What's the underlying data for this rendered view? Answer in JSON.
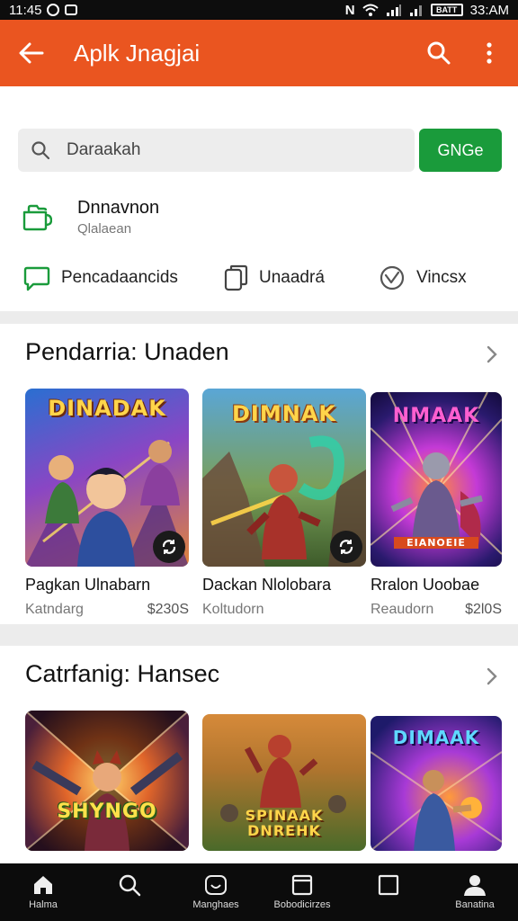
{
  "status_bar": {
    "time": "11:45",
    "right_time": "33:AM",
    "battery": "BATT"
  },
  "toolbar": {
    "title": "Aplk Jnagjai"
  },
  "search": {
    "value": "Daraakah",
    "button_label": "GNGe"
  },
  "download_row": {
    "title": "Dnnavnon",
    "subtitle": "Qlalaean"
  },
  "chips": [
    {
      "label": "Pencadaancids",
      "icon": "chat-bubble-icon"
    },
    {
      "label": "Unaadrá",
      "icon": "device-icon"
    },
    {
      "label": "Vincsx",
      "icon": "checkmark-shield-icon"
    }
  ],
  "section1": {
    "title": "Pendarria: Unaden",
    "cards": [
      {
        "art_title": "DINADAK",
        "title": "Pagkan Ulnabarn",
        "meta": "Katndarg",
        "price": "$230S",
        "badge": true
      },
      {
        "art_title": "DIMNAK",
        "title": "Dackan Nlolobara",
        "meta": "Koltudorn",
        "price": "",
        "badge": true
      },
      {
        "art_title": "NMAAK",
        "art_caption": "EIANOEIE",
        "title": "Rralon Uoobae",
        "meta": "Reaudorn",
        "price": "$2l0S",
        "badge": false
      }
    ]
  },
  "section2": {
    "title": "Catrfanig: Hansec",
    "cards": [
      {
        "art_title": "SHYNGO"
      },
      {
        "art_title": "SPINAAK DNREHK"
      },
      {
        "art_title": "DIMAAK"
      }
    ]
  },
  "bottom_nav": [
    {
      "label": "Halma",
      "icon": "home-icon"
    },
    {
      "label": "",
      "icon": "search-icon"
    },
    {
      "label": "Manghaes",
      "icon": "games-icon"
    },
    {
      "label": "Bobodicirzes",
      "icon": "apps-icon"
    },
    {
      "label": "",
      "icon": "library-icon"
    },
    {
      "label": "Banatina",
      "icon": "account-icon"
    }
  ]
}
